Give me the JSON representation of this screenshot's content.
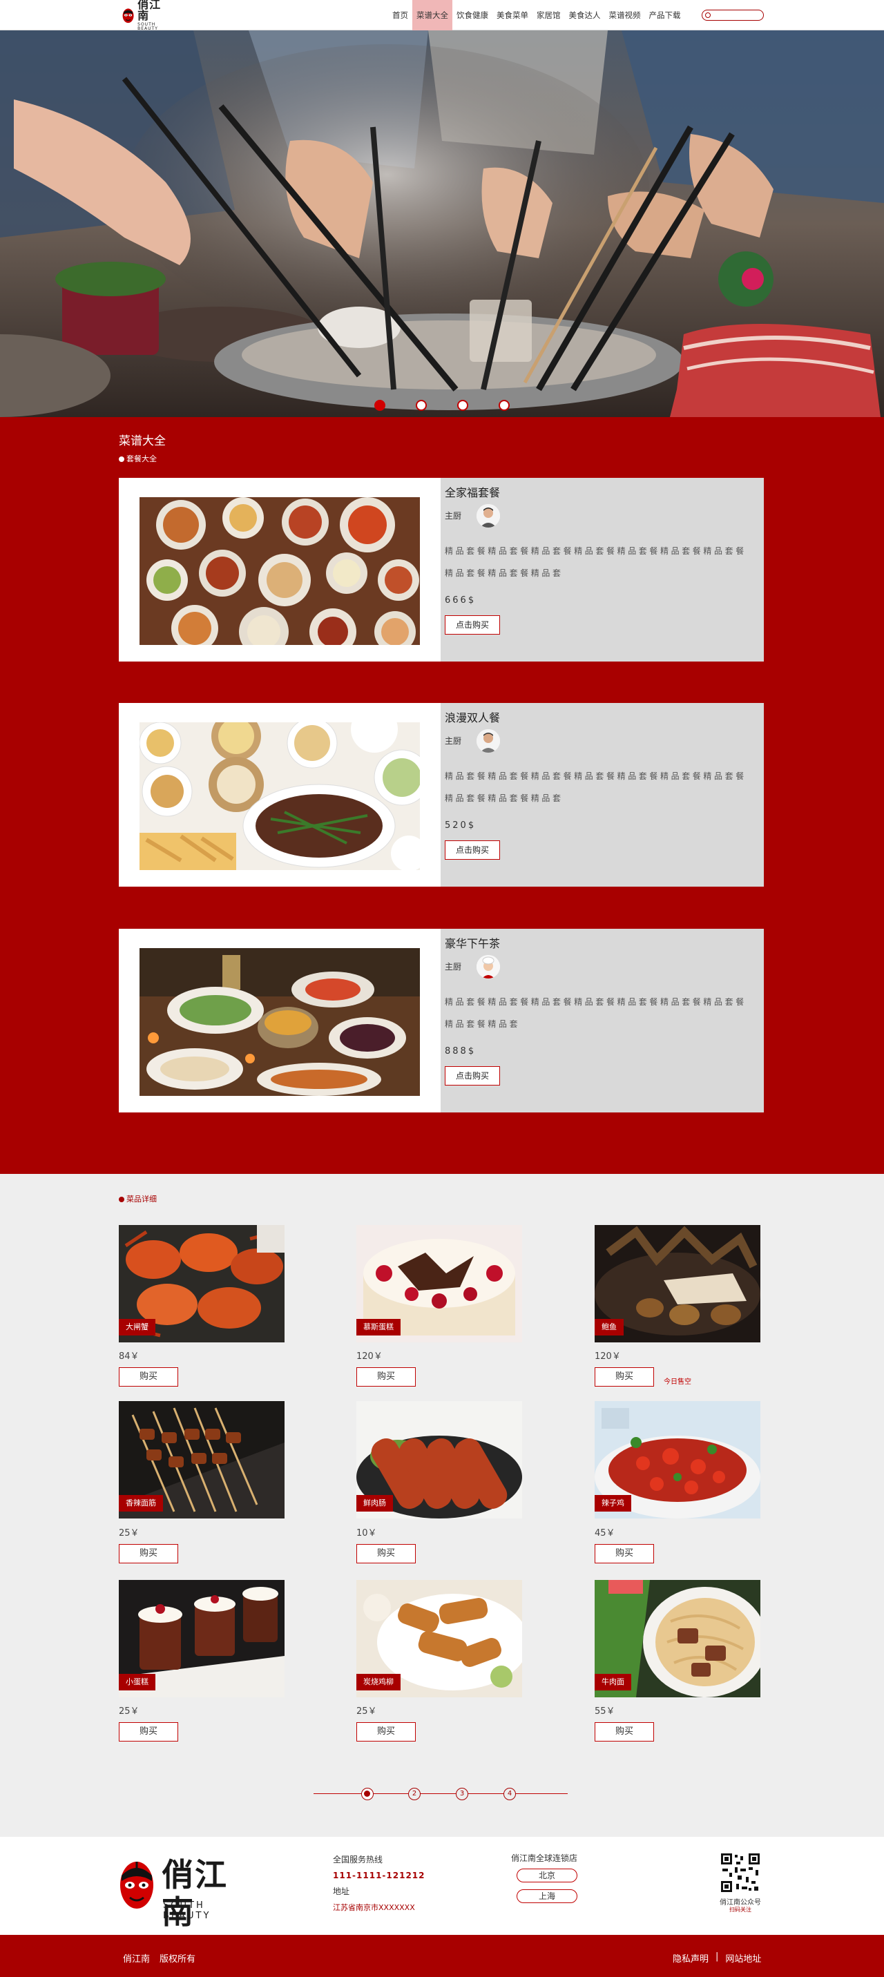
{
  "header": {
    "logo_cn": "俏江南",
    "logo_en": "SOUTH BEAUTY",
    "nav": [
      "首页",
      "菜谱大全",
      "饮食健康",
      "美食菜单",
      "家居馆",
      "美食达人",
      "菜谱视频",
      "产品下载"
    ],
    "active_nav": "菜谱大全",
    "search_placeholder": ""
  },
  "hero": {
    "slides": 4,
    "active_slide": 1
  },
  "set_meals": {
    "title": "菜谱大全",
    "subtitle": "套餐大全",
    "items": [
      {
        "name": "全家福套餐",
        "chef_label": "主厨",
        "desc": "精品套餐精品套餐精品套餐精品套餐精品套餐精品套餐精品套餐精品套餐精品套餐精品套",
        "price": "666$",
        "buy": "点击购买"
      },
      {
        "name": "浪漫双人餐",
        "chef_label": "主厨",
        "desc": "精品套餐精品套餐精品套餐精品套餐精品套餐精品套餐精品套餐精品套餐精品套餐精品套",
        "price": "520$",
        "buy": "点击购买"
      },
      {
        "name": "豪华下午茶",
        "chef_label": "主厨",
        "desc": "精品套餐精品套餐精品套餐精品套餐精品套餐精品套餐精品套餐精品套餐精品套",
        "price": "888$",
        "buy": "点击购买"
      }
    ]
  },
  "dishes": {
    "title": "菜品详细",
    "sold_out": "今日售空",
    "items": [
      {
        "name": "大闸蟹",
        "price": "84￥",
        "buy": "购买"
      },
      {
        "name": "慕斯蛋糕",
        "price": "120￥",
        "buy": "购买"
      },
      {
        "name": "鲍鱼",
        "price": "120￥",
        "buy": "购买"
      },
      {
        "name": "香辣面筋",
        "price": "25￥",
        "buy": "购买"
      },
      {
        "name": "鲜肉肠",
        "price": "10￥",
        "buy": "购买"
      },
      {
        "name": "辣子鸡",
        "price": "45￥",
        "buy": "购买"
      },
      {
        "name": "小蛋糕",
        "price": "25￥",
        "buy": "购买"
      },
      {
        "name": "炭烧鸡柳",
        "price": "25￥",
        "buy": "购买"
      },
      {
        "name": "牛肉面",
        "price": "55￥",
        "buy": "购买"
      }
    ],
    "pages": [
      "1",
      "2",
      "3",
      "4"
    ],
    "current_page": "1"
  },
  "footer": {
    "logo_cn": "俏江南",
    "logo_en": "SOUTH BEAUTY",
    "hotline_label": "全国服务热线",
    "hotline": "111-1111-121212",
    "address_label": "地址",
    "address": "江苏省南京市XXXXXXX",
    "chain_title": "俏江南全球连锁店",
    "cities": [
      "北京",
      "上海"
    ],
    "qr_title": "俏江南公众号",
    "qr_sub": "扫码关注"
  },
  "bottom": {
    "left": [
      "俏江南",
      "版权所有"
    ],
    "right": [
      "隐私声明",
      "|",
      "网站地址"
    ]
  }
}
